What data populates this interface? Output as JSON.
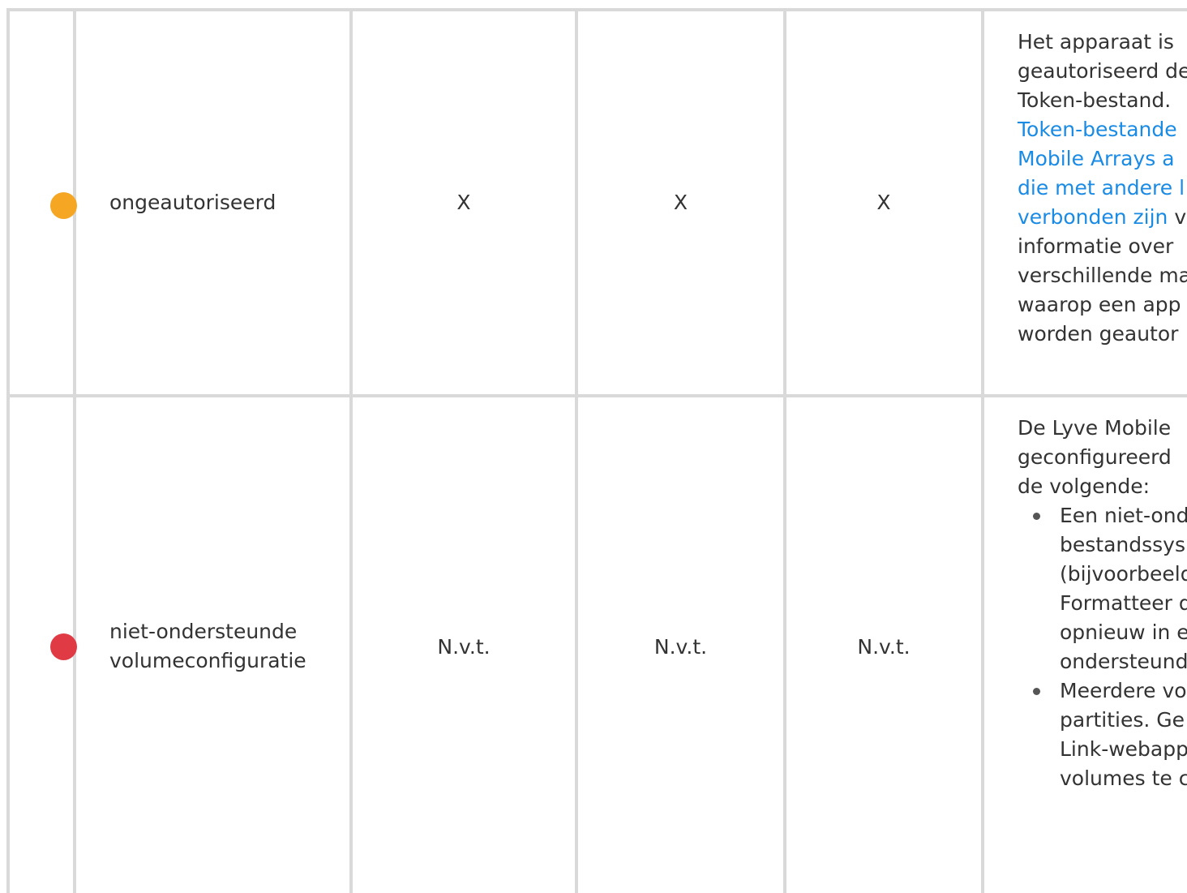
{
  "rows": [
    {
      "status_color": "#f5a623",
      "state": "ongeautoriseerd",
      "col2": "X",
      "col3": "X",
      "col4": "X",
      "description": {
        "lines_before": [
          "Het apparaat is",
          "geautoriseerd de",
          "Token-bestand."
        ],
        "link_lines": [
          "Token-bestande",
          "Mobile Arrays a",
          "die met andere l",
          "verbonden zijn"
        ],
        "link_tail": " v",
        "lines_after": [
          "informatie over",
          "verschillende ma",
          "waarop een app",
          "worden geautor"
        ]
      }
    },
    {
      "status_color": "#e03a45",
      "state_line1": "niet-ondersteunde",
      "state_line2": "volumeconfiguratie",
      "col2": "N.v.t.",
      "col3": "N.v.t.",
      "col4": "N.v.t.",
      "description": {
        "intro": [
          "De Lyve Mobile",
          "geconfigureerd",
          "de volgende:"
        ],
        "bullet1": [
          "Een niet-ond",
          "bestandssys",
          "(bijvoorbeeld",
          "Formatteer d",
          "opnieuw in e",
          "ondersteund"
        ],
        "bullet2": [
          "Meerdere vo",
          "partities. Ge",
          "Link-webapp",
          "volumes te c"
        ]
      }
    }
  ]
}
